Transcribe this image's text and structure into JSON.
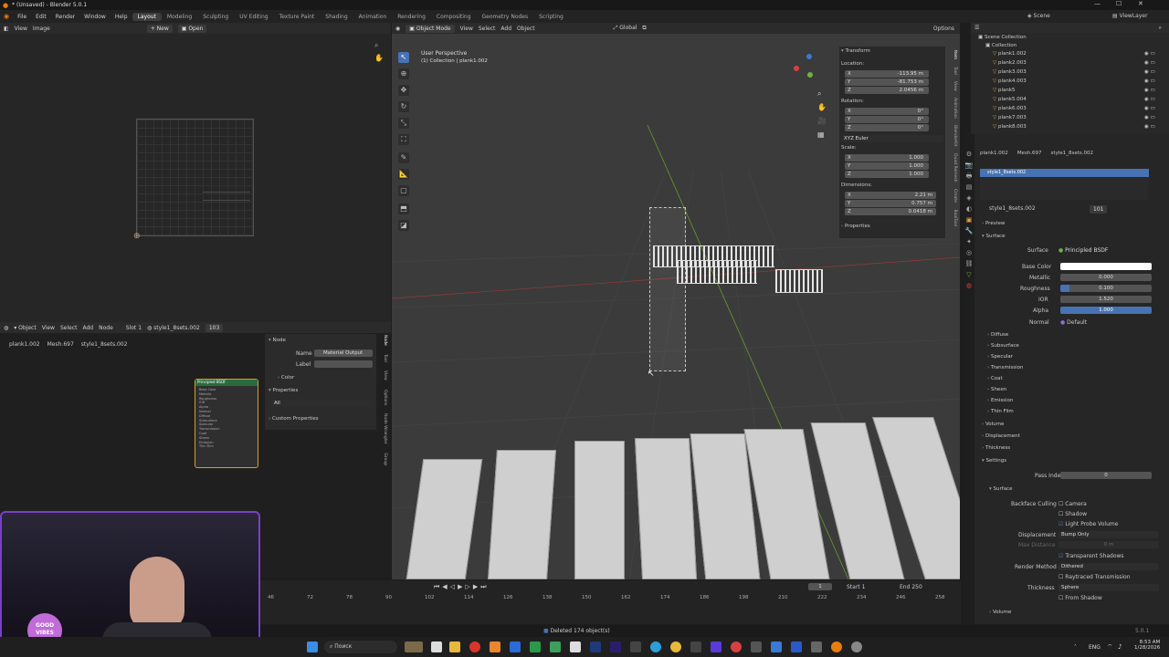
{
  "window": {
    "title": "* (Unsaved) - Blender 5.0.1",
    "min": "—",
    "max": "☐",
    "close": "✕"
  },
  "menu": [
    "File",
    "Edit",
    "Render",
    "Window",
    "Help"
  ],
  "workspaces": [
    "Layout",
    "Modeling",
    "Sculpting",
    "UV Editing",
    "Texture Paint",
    "Shading",
    "Animation",
    "Rendering",
    "Compositing",
    "Geometry Nodes",
    "Scripting"
  ],
  "scene": {
    "label": "Scene",
    "view_layer": "ViewLayer"
  },
  "image_editor": {
    "view": "View",
    "image": "Image",
    "new": "New",
    "open": "Open"
  },
  "node_editor": {
    "mode": "Object",
    "view": "View",
    "select": "Select",
    "add": "Add",
    "node": "Node",
    "slot": "Slot 1",
    "material": "style1_8sets.002",
    "users": "103",
    "breadcrumb": [
      "plank1.002",
      "Mesh.697",
      "style1_8sets.002"
    ],
    "node_title": "Principled BSDF",
    "node_sockets": [
      "Base Color",
      "Metallic",
      "Roughness",
      "IOR",
      "Alpha",
      "Normal",
      "Diffuse",
      "Subsurface",
      "Specular",
      "Transmission",
      "Coat",
      "Sheen",
      "Emission",
      "Thin Film"
    ],
    "side": {
      "section": "Node",
      "name_label": "Name",
      "name_value": "Material Output",
      "label_label": "Label",
      "color": "Color",
      "properties": "Properties",
      "all": "All",
      "custom": "Custom Properties"
    },
    "tabs": [
      "Node",
      "Tool",
      "View",
      "Options",
      "Node Wrangler",
      "Group"
    ]
  },
  "viewport": {
    "mode": "Object Mode",
    "view": "View",
    "select": "Select",
    "add": "Add",
    "object": "Object",
    "orientation": "Global",
    "options": "Options",
    "info1": "User Perspective",
    "info2": "(1) Collection | plank1.002"
  },
  "npanel": {
    "transform": "Transform",
    "location": "Location:",
    "loc": [
      "-113.95 m",
      "-81.753 m",
      "2.0456 m"
    ],
    "rotation": "Rotation:",
    "rot": [
      "0°",
      "0°",
      "0°"
    ],
    "euler": "XYZ Euler",
    "scale": "Scale:",
    "scl": [
      "1.000",
      "1.000",
      "1.000"
    ],
    "dimensions": "Dimensions:",
    "dim": [
      "2.21 m",
      "0.757 m",
      "0.0418 m"
    ],
    "properties": "Properties",
    "axes": [
      "X",
      "Y",
      "Z"
    ],
    "tabs": [
      "Item",
      "Tool",
      "View",
      "Animation",
      "BlenderKit",
      "Quad Remesh",
      "Create",
      "BoolTool"
    ]
  },
  "outliner": {
    "title": "Scene Collection",
    "collection": "Collection",
    "items": [
      "plank1.002",
      "plank2.003",
      "plank3.003",
      "plank4.003",
      "plank5",
      "plank5.004",
      "plank6.003",
      "plank7.003",
      "plank8.003"
    ]
  },
  "properties": {
    "breadcrumb": [
      "plank1.002",
      "Mesh.697",
      "style1_8sets.002"
    ],
    "slot": "style1_8sets.002",
    "material": "style1_8sets.002",
    "users": "101",
    "preview": "Preview",
    "surface_section": "Surface",
    "surface_label": "Surface",
    "surface_value": "Principled BSDF",
    "base_color": "Base Color",
    "metallic": "Metallic",
    "metallic_v": "0.000",
    "roughness": "Roughness",
    "roughness_v": "0.100",
    "roughness_fill": 0.1,
    "ior": "IOR",
    "ior_v": "1.520",
    "alpha": "Alpha",
    "alpha_v": "1.000",
    "normal": "Normal",
    "normal_v": "Default",
    "subs": [
      "Diffuse",
      "Subsurface",
      "Specular",
      "Transmission",
      "Coat",
      "Sheen",
      "Emission",
      "Thin Film"
    ],
    "volume": "Volume",
    "displacement": "Displacement",
    "thickness": "Thickness",
    "settings": "Settings",
    "pass_index": "Pass Index",
    "pass_index_v": "0",
    "surface_sub": "Surface",
    "backface": "Backface Culling",
    "camera": "Camera",
    "shadow": "Shadow",
    "light_probe": "Light Probe Volume",
    "disp_label": "Displacement",
    "disp_v": "Bump Only",
    "max_dist": "Max Distance",
    "max_dist_v": "0 m",
    "transparent": "Transparent Shadows",
    "render_method": "Render Method",
    "render_method_v": "Dithered",
    "raytraced": "Raytraced Transmission",
    "thick_label": "Thickness",
    "thick_v": "Sphere",
    "from_shadow": "From Shadow",
    "volume2": "Volume"
  },
  "timeline": {
    "frame": "1",
    "start_label": "Start",
    "start": "1",
    "end_label": "End",
    "end": "250",
    "ticks": [
      "46",
      "72",
      "78",
      "90",
      "102",
      "114",
      "126",
      "138",
      "150",
      "162",
      "174",
      "186",
      "198",
      "210",
      "222",
      "234",
      "246",
      "258"
    ]
  },
  "status": {
    "message": "Deleted 174 object(s)",
    "version": "5.0.1"
  },
  "taskbar": {
    "search": "Поиск",
    "lang": "ENG",
    "time": "8:53 AM",
    "date": "1/28/2026",
    "webcam_logo": "GOOD VIBES"
  },
  "colors": {
    "accent": "#4772b3",
    "active_orange": "#e8a33b"
  }
}
